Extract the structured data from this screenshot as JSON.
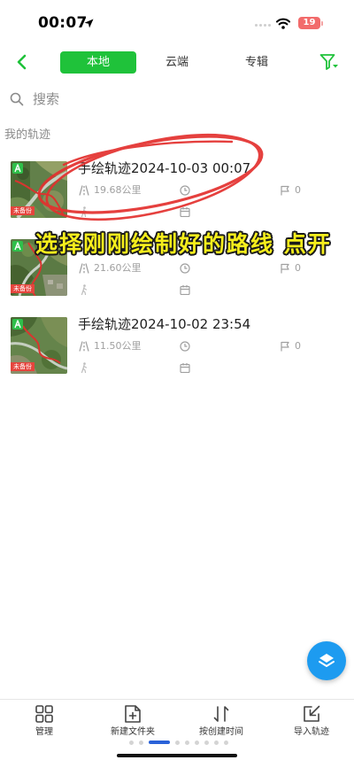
{
  "status_bar": {
    "time": "00:07",
    "battery_level": "19"
  },
  "header": {
    "tabs": [
      {
        "label": "本地",
        "selected": true
      },
      {
        "label": "云端",
        "selected": false
      },
      {
        "label": "专辑",
        "selected": false
      }
    ]
  },
  "search": {
    "placeholder": "搜索"
  },
  "section_title": "我的轨迹",
  "tracks": [
    {
      "title": "手绘轨迹2024-10-03 00:07",
      "distance": "19.68公里",
      "points": "0",
      "backup_status": "未备份"
    },
    {
      "distance": "21.60公里",
      "points": "0",
      "backup_status": "未备份"
    },
    {
      "title": "手绘轨迹2024-10-02 23:54",
      "distance": "11.50公里",
      "points": "0",
      "backup_status": "未备份"
    }
  ],
  "annotation": {
    "caption": "选择刚刚绘制好的路线 点开"
  },
  "toolbar": {
    "items": [
      {
        "label": "管理",
        "icon": "grid-icon"
      },
      {
        "label": "新建文件夹",
        "icon": "new-folder-icon"
      },
      {
        "label": "按创建时间",
        "icon": "sort-icon"
      },
      {
        "label": "导入轨迹",
        "icon": "import-icon"
      }
    ]
  },
  "pager": {
    "pages": 9,
    "current": 3
  },
  "icons": {
    "back": "chevron-left-icon",
    "filter": "filter-icon",
    "search": "search-icon",
    "fab": "layers-icon",
    "distance": "road-icon",
    "duration": "clock-icon",
    "points": "flag-icon",
    "activity": "walker-icon",
    "date": "calendar-icon",
    "thumb_badge": "hand-drawn-badge-icon"
  },
  "colors": {
    "accent": "#1fc23a",
    "fab": "#1d9bf0",
    "badge-red": "#e5453d",
    "caption-yellow": "#f6ee1c",
    "annotation-red": "#e3302e",
    "battery": "#f26b6b"
  }
}
